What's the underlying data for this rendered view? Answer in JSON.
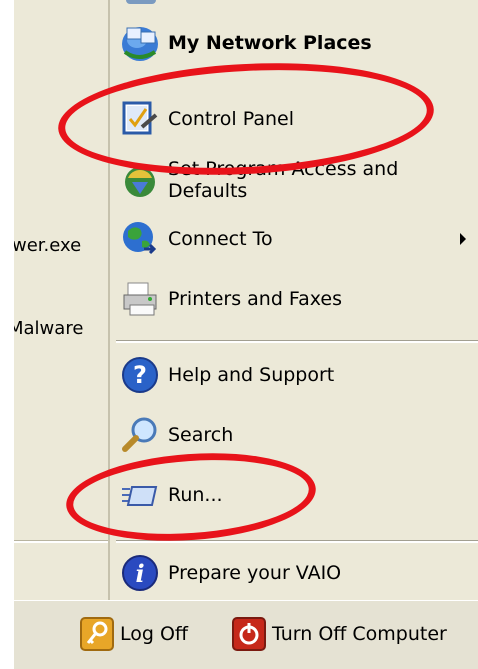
{
  "left_panel": {
    "items": [
      {
        "label": "wer.exe"
      },
      {
        "label": "Malware"
      }
    ]
  },
  "menu": {
    "items": [
      {
        "label": "My Network Places",
        "icon": "network-places-icon"
      },
      {
        "label": "Control Panel",
        "icon": "control-panel-icon"
      },
      {
        "label": "Set Program Access and Defaults",
        "icon": "program-access-icon"
      },
      {
        "label": "Connect To",
        "icon": "connect-to-icon"
      },
      {
        "label": "Printers and Faxes",
        "icon": "printer-icon"
      },
      {
        "label": "Help and Support",
        "icon": "help-icon"
      },
      {
        "label": "Search",
        "icon": "search-icon"
      },
      {
        "label": "Run...",
        "icon": "run-icon"
      },
      {
        "label": "Prepare your VAIO",
        "icon": "info-icon"
      }
    ]
  },
  "footer": {
    "log_off": "Log Off",
    "turn_off": "Turn Off Computer"
  },
  "colors": {
    "menu_bg": "#ece9d8",
    "highlight_ellipse": "#e8131a"
  }
}
